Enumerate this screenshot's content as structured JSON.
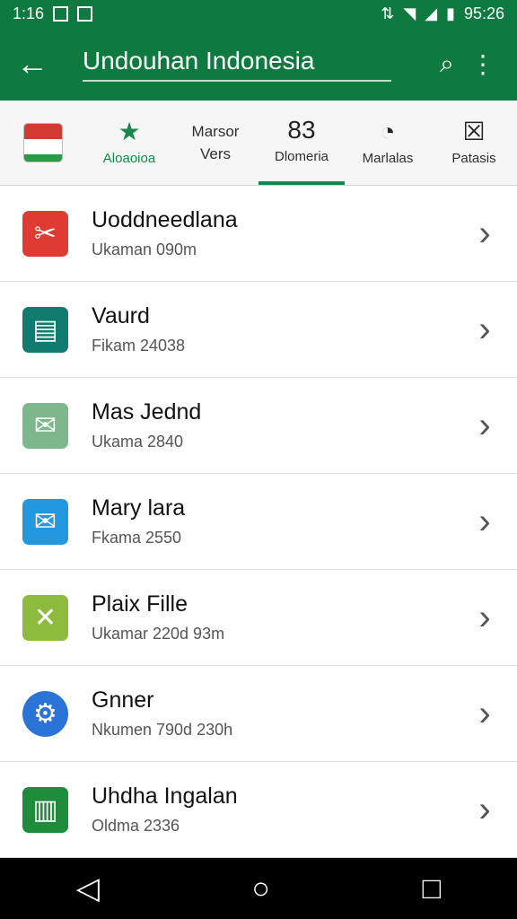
{
  "status": {
    "time": "1:16",
    "right_time": "95:26"
  },
  "appbar": {
    "title": "Undouhan Indonesia"
  },
  "tabs": [
    {
      "label": "Aloaoioa",
      "icon": "star-icon"
    },
    {
      "label": "Marsor\nVers",
      "icon": "text-icon"
    },
    {
      "label": "Dlomeria",
      "icon": "number-icon",
      "active_text": "83"
    },
    {
      "label": "Marlalas",
      "icon": "clock-icon"
    },
    {
      "label": "Patasis",
      "icon": "close-box-icon"
    }
  ],
  "items": [
    {
      "name": "Uoddneedlana",
      "sub": "Ukaman 090m",
      "color": "#e03b33",
      "icon": "tools-icon"
    },
    {
      "name": "Vaurd",
      "sub": "Fikam 24038",
      "color": "#127b70",
      "icon": "document-icon"
    },
    {
      "name": "Mas Jednd",
      "sub": "Ukama 2840",
      "color": "#7cb88b",
      "icon": "mail-icon"
    },
    {
      "name": "Mary lara",
      "sub": "Fkama 2550",
      "color": "#2398df",
      "icon": "envelope-icon"
    },
    {
      "name": "Plaix Fille",
      "sub": "Ukamar 220d 93m",
      "color": "#8dbb3e",
      "icon": "file-icon"
    },
    {
      "name": "Gnner",
      "sub": "Nkumen 790d 230h",
      "color": "#2b74d7",
      "icon": "gear-icon"
    },
    {
      "name": "Uhdha Ingalan",
      "sub": "Oldma 2336",
      "color": "#1d8d3b",
      "icon": "book-icon"
    }
  ]
}
